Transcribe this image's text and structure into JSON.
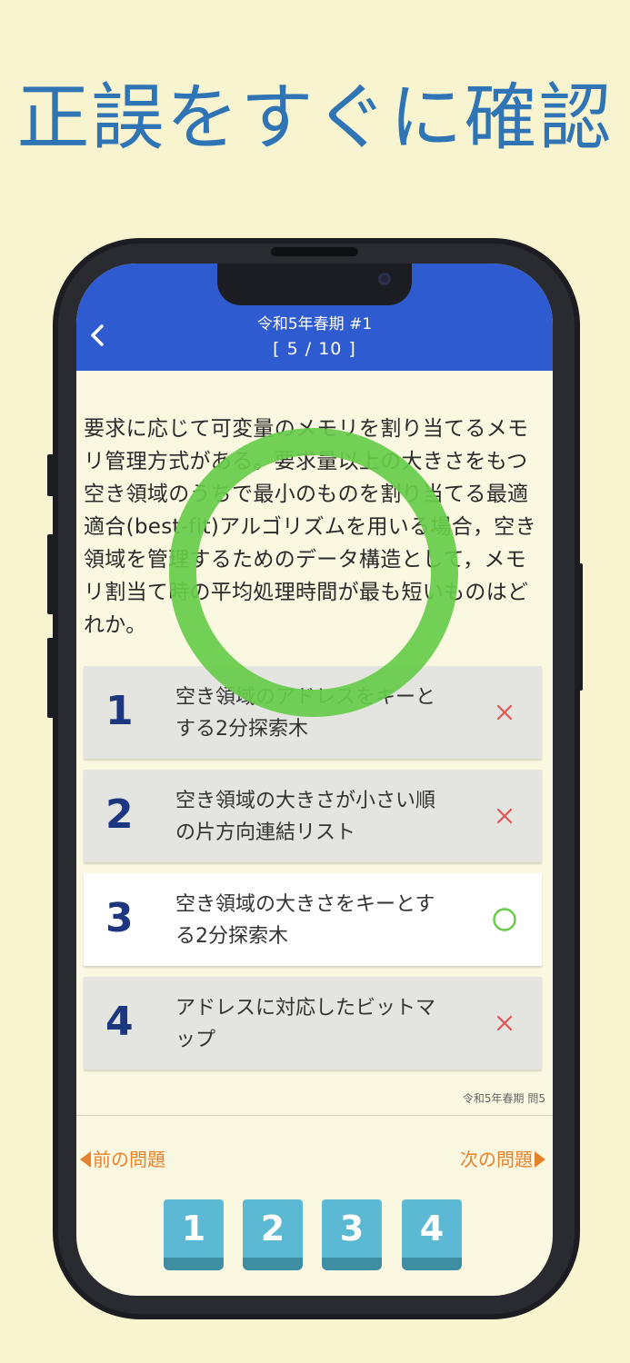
{
  "headline": "正誤をすぐに確認",
  "header": {
    "title": "令和5年春期 #1",
    "progress": "[ 5 / 10 ]"
  },
  "question": {
    "text": "要求に応じて可変量のメモリを割り当てるメモリ管理方式がある。要求量以上の大きさをもつ空き領域のうちで最小のものを割り当てる最適適合(best-fit)アルゴリズムを用いる場合，空き領域を管理するためのデータ構造として，メモリ割当て時の平均処理時間が最も短いものはどれか。"
  },
  "choices": [
    {
      "number": "1",
      "line1": "空き領域のアドレスをキーと",
      "line2": "する2分探索木",
      "result": "×"
    },
    {
      "number": "2",
      "line1": "空き領域の大きさが小さい順",
      "line2": "の片方向連結リスト",
      "result": "×"
    },
    {
      "number": "3",
      "line1": "空き領域の大きさをキーとす",
      "line2": "る2分探索木",
      "result": "○"
    },
    {
      "number": "4",
      "line1": "アドレスに対応したビットマ",
      "line2": "ップ",
      "result": "×"
    }
  ],
  "source": "令和5年春期 問5",
  "nav": {
    "prev": "前の問題",
    "next": "次の問題"
  },
  "answer_buttons": [
    "1",
    "2",
    "3",
    "4"
  ],
  "colors": {
    "background": "#f8f4cf",
    "headline": "#2f74b4",
    "navbar": "#2f5bd0",
    "correct": "#66cc4a",
    "wrong": "#e25555",
    "nav_link": "#e5822b",
    "answer_button": "#5bb9d3"
  },
  "icons": {
    "back": "chevron-left-icon",
    "correct_overlay": "big-circle-icon",
    "correct_mark": "circle-icon",
    "wrong_mark": "cross-icon"
  }
}
